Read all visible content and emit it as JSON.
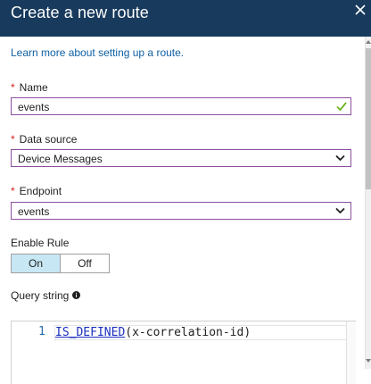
{
  "header": {
    "title": "Create a new route"
  },
  "learn_more_link": "Learn more about setting up a route.",
  "name_field": {
    "label": "Name",
    "required": "*",
    "value": "events"
  },
  "data_source_field": {
    "label": "Data source",
    "required": "*",
    "value": "Device Messages"
  },
  "endpoint_field": {
    "label": "Endpoint",
    "required": "*",
    "value": "events"
  },
  "enable_rule": {
    "label": "Enable Rule",
    "on_label": "On",
    "off_label": "Off",
    "selected": "On"
  },
  "query_string": {
    "label": "Query string",
    "line_number": "1",
    "function_name": "IS_DEFINED",
    "argument": "(x-correlation-id)"
  },
  "colors": {
    "header_bg": "#183a5c",
    "accent_border": "#8b4f9e",
    "link": "#0f5fa3",
    "required": "#d42020",
    "toggle_selected": "#c7e7f4",
    "valid_check": "#6cb21e"
  },
  "icons": [
    "close-icon",
    "checkmark-icon",
    "chevron-down-icon",
    "info-icon"
  ]
}
